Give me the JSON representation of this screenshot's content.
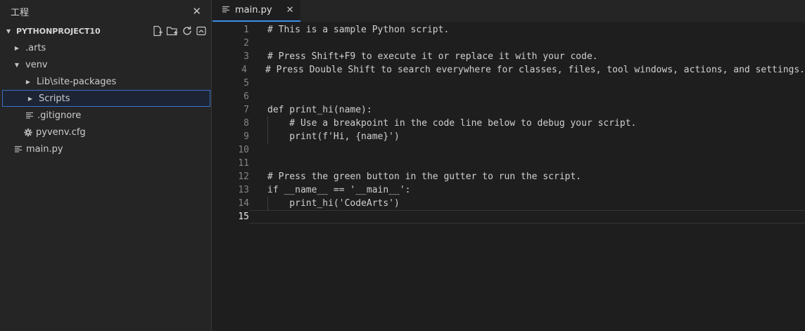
{
  "sidebar": {
    "title": "工程",
    "project_name": "PYTHONPROJECT10",
    "tree": [
      {
        "label": ".arts"
      },
      {
        "label": "venv"
      },
      {
        "label": "Lib\\site-packages"
      },
      {
        "label": "Scripts"
      },
      {
        "label": ".gitignore"
      },
      {
        "label": "pyvenv.cfg"
      },
      {
        "label": "main.py"
      }
    ]
  },
  "editor": {
    "tab_label": "main.py",
    "lines": [
      {
        "n": "1",
        "text": "# This is a sample Python script."
      },
      {
        "n": "2",
        "text": ""
      },
      {
        "n": "3",
        "text": "# Press Shift+F9 to execute it or replace it with your code."
      },
      {
        "n": "4",
        "text": "# Press Double Shift to search everywhere for classes, files, tool windows, actions, and settings."
      },
      {
        "n": "5",
        "text": ""
      },
      {
        "n": "6",
        "text": ""
      },
      {
        "n": "7",
        "text": "def print_hi(name):"
      },
      {
        "n": "8",
        "text": "    # Use a breakpoint in the code line below to debug your script."
      },
      {
        "n": "9",
        "text": "    print(f'Hi, {name}')"
      },
      {
        "n": "10",
        "text": ""
      },
      {
        "n": "11",
        "text": ""
      },
      {
        "n": "12",
        "text": "# Press the green button in the gutter to run the script."
      },
      {
        "n": "13",
        "text": "if __name__ == '__main__':"
      },
      {
        "n": "14",
        "text": "    print_hi('CodeArts')"
      },
      {
        "n": "15",
        "text": ""
      }
    ]
  }
}
